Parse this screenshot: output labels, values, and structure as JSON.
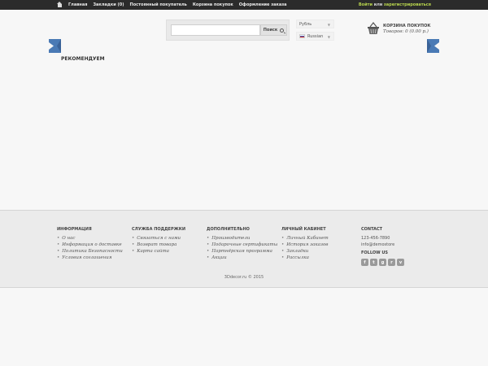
{
  "topnav": {
    "items": [
      {
        "label": "Главная"
      },
      {
        "label": "Закладки (0)"
      },
      {
        "label": "Постоянный покупатель"
      },
      {
        "label": "Корзина покупок"
      },
      {
        "label": "Оформление заказа"
      }
    ],
    "login": {
      "enter": "Войти",
      "or": "или",
      "register": "зарегистрироваться"
    }
  },
  "search": {
    "placeholder": "",
    "button_label": "Поиск"
  },
  "currency": {
    "selected": "Рубль"
  },
  "language": {
    "selected": "Russian"
  },
  "cart": {
    "title": "КОРЗИНА ПОКУПОК",
    "total": "Товаров: 0 (0.00 р.)"
  },
  "main": {
    "section_title": "РЕКОМЕНДУЕМ"
  },
  "footer": {
    "columns": [
      {
        "title": "ИНФОРМАЦИЯ",
        "items": [
          "О нас",
          "Информация о доставке",
          "Политика Безопасности",
          "Условия соглашения"
        ]
      },
      {
        "title": "СЛУЖБА ПОДДЕРЖКИ",
        "items": [
          "Связаться с нами",
          "Возврат товара",
          "Карта сайта"
        ]
      },
      {
        "title": "ДОПОЛНИТЕЛЬНО",
        "items": [
          "Производители",
          "Подарочные сертификаты",
          "Партнёрская программа",
          "Акции"
        ]
      },
      {
        "title": "ЛИЧНЫЙ КАБИНЕТ",
        "items": [
          "Личный Кабинет",
          "История заказов",
          "Закладки",
          "Рассылка"
        ]
      }
    ],
    "contact": {
      "title": "CONTACT",
      "phone": "123-456-7890",
      "email": "info@demostore",
      "follow_title": "FOLLOW US"
    },
    "socials": [
      {
        "icon": "facebook-icon",
        "glyph": "f"
      },
      {
        "icon": "twitter-icon",
        "glyph": "t"
      },
      {
        "icon": "googleplus-icon",
        "glyph": "g"
      },
      {
        "icon": "rss-icon",
        "glyph": "r"
      },
      {
        "icon": "vimeo-icon",
        "glyph": "v"
      }
    ],
    "copyright": "3Ddecor.ru © 2015"
  },
  "colors": {
    "topbar": "#2b2b2b",
    "accent_green": "#b6d24d",
    "arrow_blue": "#4a7ab5",
    "footer_bg": "#ebebeb"
  }
}
